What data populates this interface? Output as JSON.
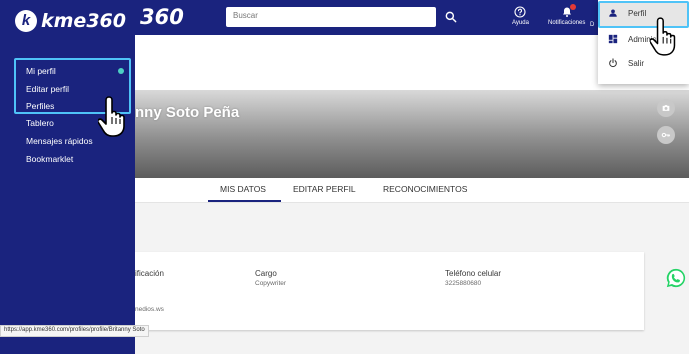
{
  "app": {
    "logo_letter": "k",
    "logo_text": "kme360",
    "logo_partial": "360"
  },
  "topbar": {
    "search_placeholder": "Buscar",
    "help_label": "Ayuda",
    "notifications_label": "Notificaciones",
    "cut_label": "D"
  },
  "sidebar": {
    "items": [
      {
        "label": "Mi perfil"
      },
      {
        "label": "Editar perfil"
      },
      {
        "label": "Perfiles"
      },
      {
        "label": "Tablero"
      },
      {
        "label": "Mensajes rápidos"
      },
      {
        "label": "Bookmarklet"
      }
    ]
  },
  "profile": {
    "name": "nny Soto Peña"
  },
  "tabs": [
    {
      "label": "MIS DATOS"
    },
    {
      "label": "EDITAR PERFIL"
    },
    {
      "label": "RECONOCIMIENTOS"
    }
  ],
  "info": {
    "col1_label": "ificación",
    "col1_value": "nedios.ws",
    "cargo_label": "Cargo",
    "cargo_value": "Copywriter",
    "telefono_label": "Teléfono celular",
    "telefono_value": "3225880680"
  },
  "dropdown": {
    "items": [
      {
        "label": "Perfil",
        "icon": "person-icon"
      },
      {
        "label": "Adminis",
        "icon": "dashboard-icon"
      },
      {
        "label": "Salir",
        "icon": "power-icon"
      }
    ]
  },
  "status_url": "https://app.kme360.com/profiles/profile/Britanny Soto",
  "colors": {
    "primary": "#1a237e",
    "highlight": "#4fc3f7",
    "accent_dot": "#4dd0c4",
    "whatsapp": "#25d366",
    "notification_badge": "#e53935"
  }
}
